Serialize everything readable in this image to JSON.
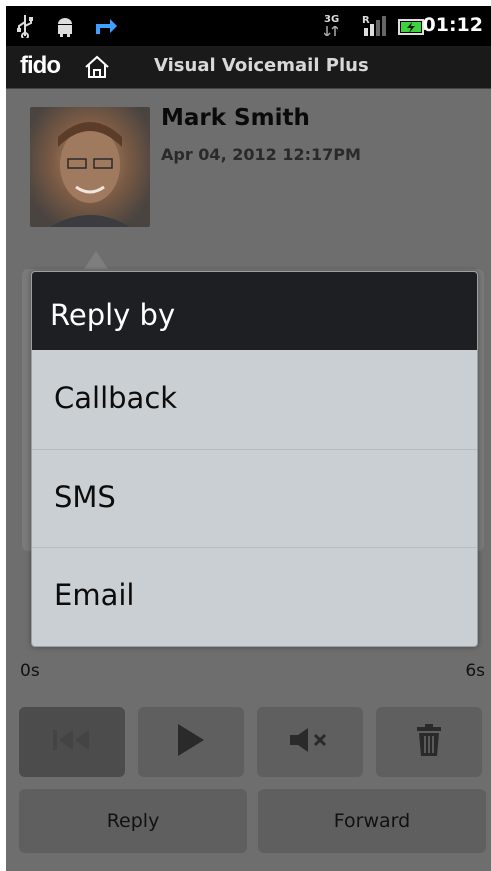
{
  "status_bar": {
    "time": "01:12",
    "network": "3G",
    "roaming": "R",
    "icons": [
      "usb-icon",
      "android-debug-icon",
      "transfer-icon",
      "network-3g-icon",
      "signal-icon",
      "battery-charging-icon"
    ]
  },
  "title_bar": {
    "brand": "fido",
    "title": "Visual Voicemail Plus"
  },
  "message": {
    "contact_name": "Mark Smith",
    "date": "Apr 04, 2012 12:17PM"
  },
  "player": {
    "time_start": "0s",
    "time_end": "6s"
  },
  "actions": {
    "reply": "Reply",
    "forward": "Forward"
  },
  "dialog": {
    "title": "Reply by",
    "options": [
      "Callback",
      "SMS",
      "Email"
    ]
  },
  "colors": {
    "status_bar_bg": "#000000",
    "dialog_header_bg": "#1d1f22",
    "dialog_body_bg": "#c9cfd3",
    "dim_background": "#6e6e6e"
  }
}
